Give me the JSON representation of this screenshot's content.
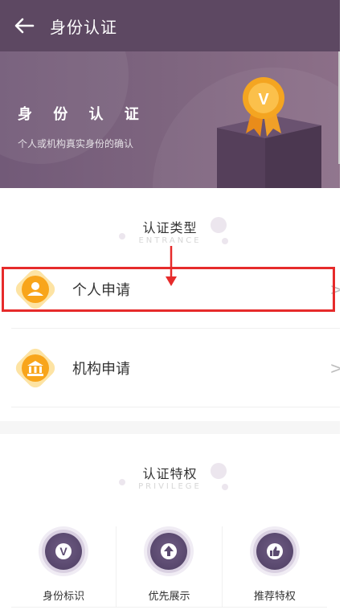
{
  "header": {
    "title": "身份认证",
    "back_icon": "back-arrow-icon"
  },
  "hero": {
    "title": "身 份 认 证",
    "subtitle": "个人或机构真实身份的确认",
    "badge_letter": "V"
  },
  "types_section": {
    "title": "认证类型",
    "subtitle": "ENTRANCE",
    "items": [
      {
        "label": "个人申请",
        "icon": "person-icon",
        "chevron": ">"
      },
      {
        "label": "机构申请",
        "icon": "bank-icon",
        "chevron": ">"
      }
    ]
  },
  "privilege_section": {
    "title": "认证特权",
    "subtitle": "PRIVILEGE",
    "items": [
      {
        "label": "身份标识",
        "icon": "v-badge-icon",
        "glyph": "V"
      },
      {
        "label": "优先展示",
        "icon": "up-arrow-icon"
      },
      {
        "label": "推荐特权",
        "icon": "thumbs-up-icon"
      }
    ]
  },
  "colors": {
    "header_bg": "#5d4862",
    "hero_bg": "#7e657f",
    "accent_orange": "#f7a21b",
    "highlight_red": "#e62b2b",
    "privilege_icon": "#5b4a70"
  }
}
